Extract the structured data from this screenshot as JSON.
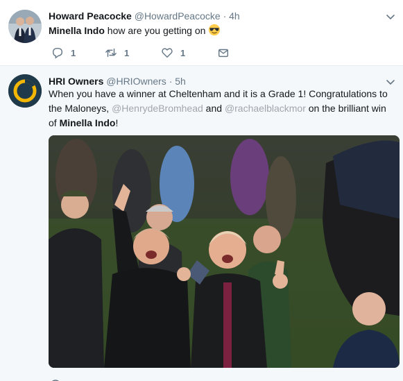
{
  "tweets": [
    {
      "display_name": "Howard Peacocke",
      "handle": "@HowardPeacocke",
      "time": "4h",
      "text_bold": "Minella Indo",
      "text_rest": " how are you getting on ",
      "emoji": "sunglasses-emoji",
      "actions": {
        "replies": "1",
        "retweets": "1",
        "likes": "1"
      }
    },
    {
      "display_name": "HRI Owners",
      "handle": "@HRIOwners",
      "time": "5h",
      "text_part1": "When you have a winner at Cheltenham and it is a Grade 1! Congratulations to the Maloneys, ",
      "mention1": "@HenrydeBromhead",
      "text_part2": " and ",
      "mention2": "@rachaelblackmor",
      "text_part3": " on the brilliant win of ",
      "text_bold": "Minella Indo",
      "text_part4": "!",
      "media_description": "photo"
    }
  ],
  "separator": "·",
  "colors": {
    "link": "#9fa7ad",
    "secondary": "#657786",
    "avatar_ring": "#f5b700"
  }
}
